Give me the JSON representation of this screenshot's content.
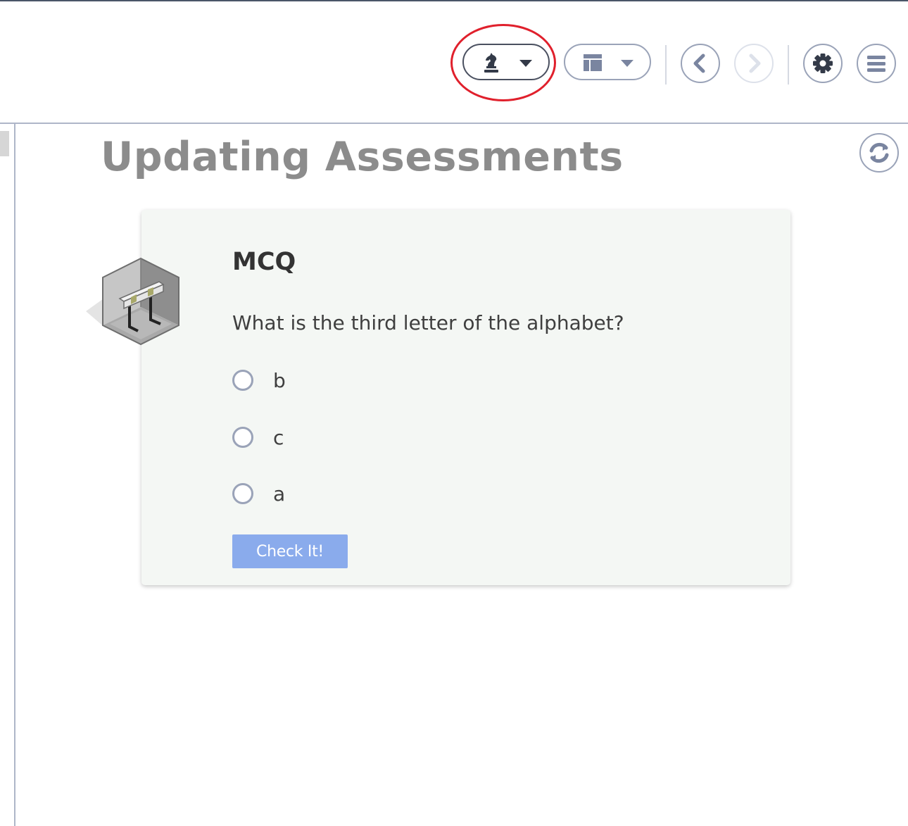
{
  "toolbar": {
    "mode_icon": "chess-knight-icon",
    "layout_icon": "layout-icon",
    "prev_icon": "chevron-left-icon",
    "next_icon": "chevron-right-icon",
    "settings_icon": "gear-icon",
    "menu_icon": "hamburger-menu-icon",
    "next_enabled": false
  },
  "annotation": {
    "color": "#e0202c"
  },
  "page": {
    "title": "Updating Assessments",
    "refresh_icon": "refresh-icon"
  },
  "card": {
    "icon": "assessment-cube-icon",
    "title": "MCQ",
    "question": "What is the third letter of the alphabet?",
    "options": [
      {
        "label": "b",
        "selected": false
      },
      {
        "label": "c",
        "selected": false
      },
      {
        "label": "a",
        "selected": false
      }
    ],
    "check_label": "Check It!"
  },
  "colors": {
    "title_gray": "#8c8c8c",
    "border": "#9aa3b8",
    "card_bg": "#f4f7f4",
    "button_blue": "#8aabec"
  }
}
